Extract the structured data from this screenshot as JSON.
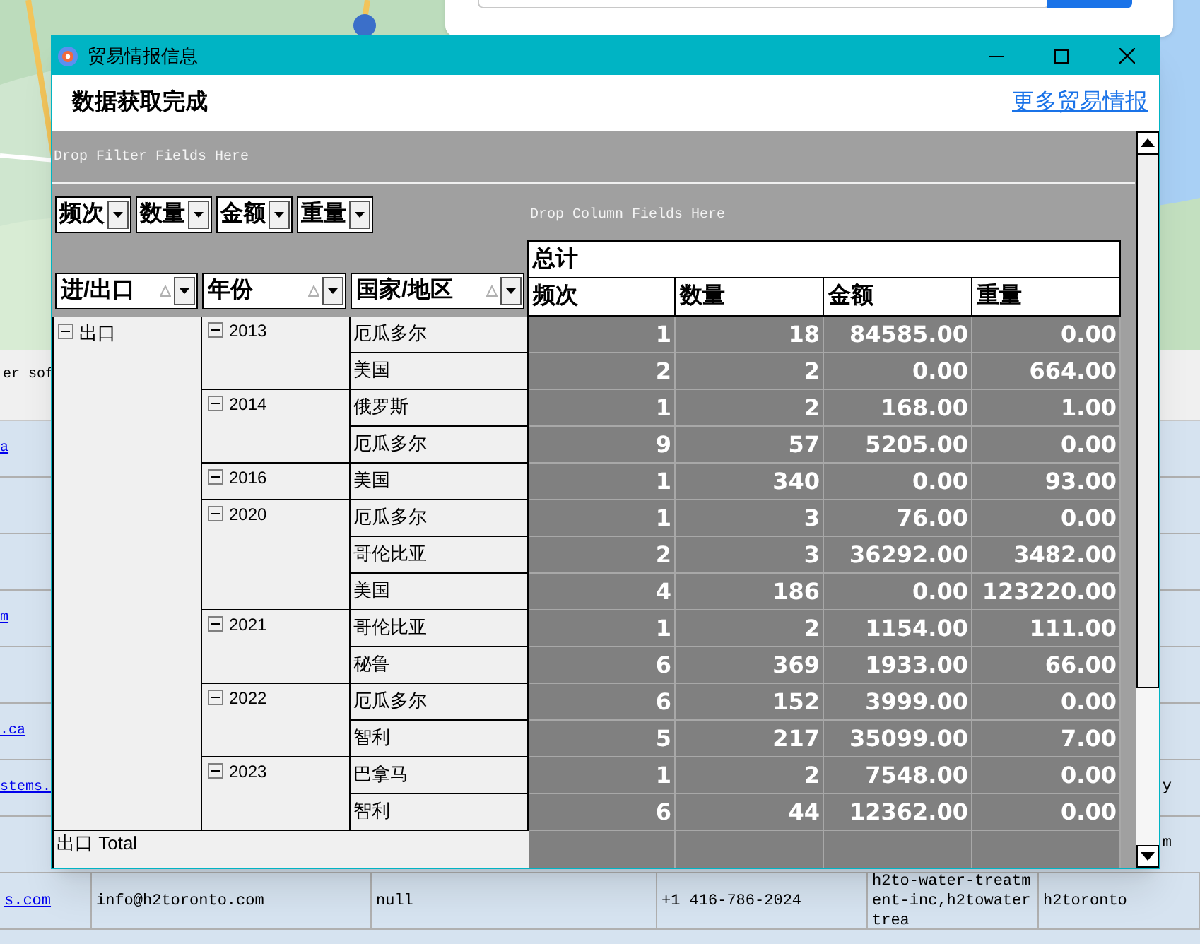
{
  "background": {
    "toolbar_text": "er sof",
    "rows": [
      {
        "left": "a"
      },
      {},
      {},
      {
        "left": "m"
      },
      {},
      {
        "left": ".ca"
      },
      {
        "left": "stems.",
        "right": "y"
      },
      {
        "right": "m"
      }
    ],
    "contact_row": [
      "s.com",
      "info@h2toronto.com",
      "null",
      "+1 416-786-2024",
      "h2to-water-treatment-inc,h2towatertrea",
      "h2toronto"
    ]
  },
  "window": {
    "title": "贸易情报信息",
    "status": "数据获取完成",
    "link": "更多贸易情报"
  },
  "pivot": {
    "filter_hint": "Drop Filter Fields Here",
    "column_hint": "Drop Column Fields Here",
    "data_fields": [
      "频次",
      "数量",
      "金额",
      "重量"
    ],
    "row_fields": [
      "进/出口",
      "年份",
      "国家/地区"
    ],
    "grand_header": "总计",
    "columns": [
      "频次",
      "数量",
      "金额",
      "重量"
    ],
    "groups": [
      {
        "label": "出口",
        "expanded": true,
        "children": [
          {
            "label": "2013",
            "expanded": true,
            "children": [
              {
                "label": "厄瓜多尔",
                "values": [
                  "1",
                  "18",
                  "84585.00",
                  "0.00"
                ]
              },
              {
                "label": "美国",
                "values": [
                  "2",
                  "2",
                  "0.00",
                  "664.00"
                ]
              }
            ]
          },
          {
            "label": "2014",
            "expanded": true,
            "children": [
              {
                "label": "俄罗斯",
                "values": [
                  "1",
                  "2",
                  "168.00",
                  "1.00"
                ]
              },
              {
                "label": "厄瓜多尔",
                "values": [
                  "9",
                  "57",
                  "5205.00",
                  "0.00"
                ]
              }
            ]
          },
          {
            "label": "2016",
            "expanded": true,
            "children": [
              {
                "label": "美国",
                "values": [
                  "1",
                  "340",
                  "0.00",
                  "93.00"
                ]
              }
            ]
          },
          {
            "label": "2020",
            "expanded": true,
            "children": [
              {
                "label": "厄瓜多尔",
                "values": [
                  "1",
                  "3",
                  "76.00",
                  "0.00"
                ]
              },
              {
                "label": "哥伦比亚",
                "values": [
                  "2",
                  "3",
                  "36292.00",
                  "3482.00"
                ]
              },
              {
                "label": "美国",
                "values": [
                  "4",
                  "186",
                  "0.00",
                  "123220.00"
                ]
              }
            ]
          },
          {
            "label": "2021",
            "expanded": true,
            "children": [
              {
                "label": "哥伦比亚",
                "values": [
                  "1",
                  "2",
                  "1154.00",
                  "111.00"
                ]
              },
              {
                "label": "秘鲁",
                "values": [
                  "6",
                  "369",
                  "1933.00",
                  "66.00"
                ]
              }
            ]
          },
          {
            "label": "2022",
            "expanded": true,
            "children": [
              {
                "label": "厄瓜多尔",
                "values": [
                  "6",
                  "152",
                  "3999.00",
                  "0.00"
                ]
              },
              {
                "label": "智利",
                "values": [
                  "5",
                  "217",
                  "35099.00",
                  "7.00"
                ]
              }
            ]
          },
          {
            "label": "2023",
            "expanded": true,
            "children": [
              {
                "label": "巴拿马",
                "values": [
                  "1",
                  "2",
                  "7548.00",
                  "0.00"
                ]
              },
              {
                "label": "智利",
                "values": [
                  "6",
                  "44",
                  "12362.00",
                  "0.00"
                ]
              }
            ]
          }
        ]
      }
    ],
    "total_label": "出口 Total"
  }
}
